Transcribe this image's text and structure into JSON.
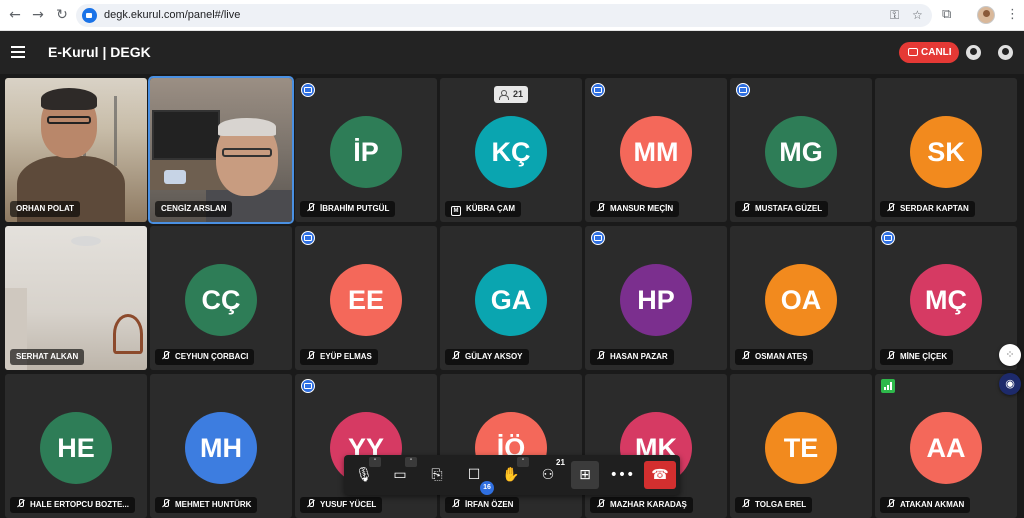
{
  "browser": {
    "back_icon": "back-arrow-icon",
    "forward_icon": "forward-arrow-icon",
    "reload_icon": "reload-icon",
    "url": "degk.ekurul.com/panel#/live"
  },
  "header": {
    "title": "E-Kurul | DEGK",
    "live_label": "CANLI",
    "live_color": "#e53935"
  },
  "participants": [
    {
      "name": "ORHAN POLAT",
      "type": "video",
      "video": "v1"
    },
    {
      "name": "CENGİZ ARSLAN",
      "type": "video",
      "video": "v2",
      "selected": true
    },
    {
      "name": "İBRAHİM PUTGÜL",
      "initials": "İP",
      "color": "#2e7d57",
      "muted": true,
      "badge": "device"
    },
    {
      "name": "KÜBRA ÇAM",
      "initials": "KÇ",
      "color": "#0aa5b0",
      "moderator": true,
      "count": "21"
    },
    {
      "name": "MANSUR MEÇİN",
      "initials": "MM",
      "color": "#f4685a",
      "muted": true,
      "badge": "device"
    },
    {
      "name": "MUSTAFA GÜZEL",
      "initials": "MG",
      "color": "#2e7d57",
      "muted": true,
      "badge": "device"
    },
    {
      "name": "SERDAR KAPTAN",
      "initials": "SK",
      "color": "#f28a1e",
      "muted": true
    },
    {
      "name": "SERHAT ALKAN",
      "type": "video",
      "video": "v3"
    },
    {
      "name": "CEYHUN ÇORBACI",
      "initials": "CÇ",
      "color": "#2e7d57",
      "muted": true
    },
    {
      "name": "EYÜP ELMAS",
      "initials": "EE",
      "color": "#f4685a",
      "muted": true,
      "badge": "device"
    },
    {
      "name": "GÜLAY AKSOY",
      "initials": "GA",
      "color": "#0aa5b0",
      "muted": true
    },
    {
      "name": "HASAN PAZAR",
      "initials": "HP",
      "color": "#7b2f8e",
      "muted": true,
      "badge": "device"
    },
    {
      "name": "OSMAN ATEŞ",
      "initials": "OA",
      "color": "#f28a1e",
      "muted": true
    },
    {
      "name": "MİNE ÇİÇEK",
      "initials": "MÇ",
      "color": "#d63a63",
      "muted": true,
      "badge": "device"
    },
    {
      "name": "HALE ERTOPCU BOZTE...",
      "initials": "HE",
      "color": "#2e7d57",
      "muted": true
    },
    {
      "name": "MEHMET HUNTÜRK",
      "initials": "MH",
      "color": "#3d7de0",
      "muted": true
    },
    {
      "name": "YUSUF YÜCEL",
      "initials": "YY",
      "color": "#d63a63",
      "muted": true,
      "badge": "device"
    },
    {
      "name": "İRFAN ÖZEN",
      "initials": "İÖ",
      "color": "#f4685a",
      "muted": true
    },
    {
      "name": "MAZHAR KARADAŞ",
      "initials": "MK",
      "color": "#d63a63",
      "muted": true
    },
    {
      "name": "TOLGA EREL",
      "initials": "TE",
      "color": "#f28a1e",
      "muted": true
    },
    {
      "name": "ATAKAN AKMAN",
      "initials": "AA",
      "color": "#f4685a",
      "muted": true,
      "badge": "signal"
    }
  ],
  "controls": {
    "chat_unread": "16",
    "participants_count": "21",
    "items": [
      "mic-icon",
      "camera-icon",
      "share-screen-icon",
      "chat-icon",
      "raise-hand-icon",
      "participants-icon",
      "grid-view-icon",
      "more-icon",
      "leave-call-icon"
    ]
  }
}
